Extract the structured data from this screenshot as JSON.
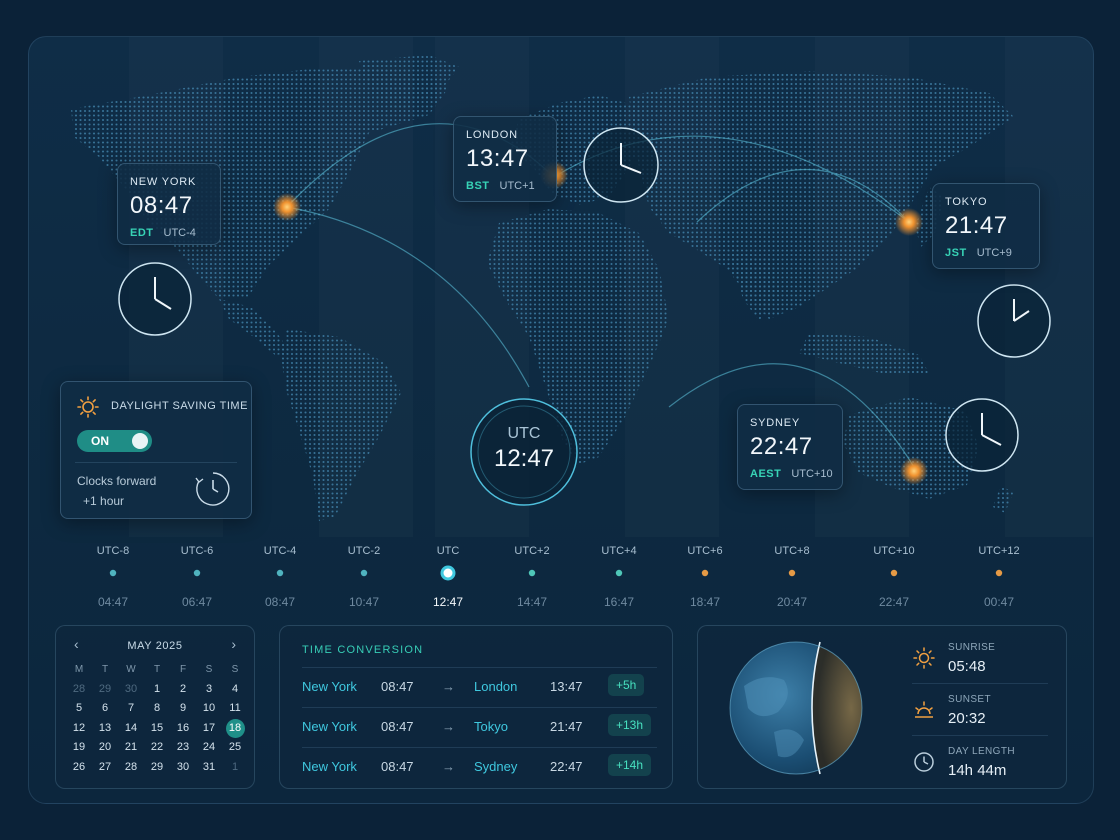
{
  "cities": {
    "new_york": {
      "name": "NEW YORK",
      "time": "08:47",
      "abbr": "EDT",
      "offset": "UTC-4"
    },
    "london": {
      "name": "LONDON",
      "time": "13:47",
      "abbr": "BST",
      "offset": "UTC+1"
    },
    "tokyo": {
      "name": "TOKYO",
      "time": "21:47",
      "abbr": "JST",
      "offset": "UTC+9"
    },
    "sydney": {
      "name": "SYDNEY",
      "time": "22:47",
      "abbr": "AEST",
      "offset": "UTC+10"
    }
  },
  "utc_clock": {
    "label": "UTC",
    "time": "12:47"
  },
  "dst": {
    "title": "DAYLIGHT SAVING TIME",
    "toggle_label": "ON",
    "toggle_on": true,
    "line1": "Clocks forward",
    "line2": "+1 hour"
  },
  "timeline": {
    "zones": [
      "UTC-8",
      "UTC-6",
      "UTC-4",
      "UTC-2",
      "UTC",
      "UTC+2",
      "UTC+4",
      "UTC+6",
      "UTC+8",
      "UTC+10",
      "UTC+12"
    ],
    "times": [
      "04:47",
      "06:47",
      "08:47",
      "10:47",
      "12:47",
      "14:47",
      "16:47",
      "18:47",
      "20:47",
      "22:47",
      "00:47"
    ],
    "active_index": 4
  },
  "calendar": {
    "month": "MAY 2025",
    "prev": "‹",
    "next": "›",
    "weekdays": [
      "M",
      "T",
      "W",
      "T",
      "F",
      "S",
      "S"
    ],
    "days": [
      "28",
      "29",
      "30",
      "1",
      "2",
      "3",
      "4",
      "5",
      "6",
      "7",
      "8",
      "9",
      "10",
      "11",
      "12",
      "13",
      "14",
      "15",
      "16",
      "17",
      "18",
      "19",
      "20",
      "21",
      "22",
      "23",
      "24",
      "25",
      "26",
      "27",
      "28",
      "29",
      "30",
      "31",
      "1"
    ],
    "muted_indices": [
      0,
      1,
      2,
      34
    ],
    "selected": "18"
  },
  "conversion": {
    "title": "TIME CONVERSION",
    "rows": [
      {
        "from": "New York",
        "from_time": "08:47",
        "arrow": "→",
        "to": "London",
        "to_time": "13:47",
        "delta": "+5h"
      },
      {
        "from": "New York",
        "from_time": "08:47",
        "arrow": "→",
        "to": "Tokyo",
        "to_time": "21:47",
        "delta": "+13h"
      },
      {
        "from": "New York",
        "from_time": "08:47",
        "arrow": "→",
        "to": "Sydney",
        "to_time": "22:47",
        "delta": "+14h"
      }
    ]
  },
  "sun": {
    "sunrise_label": "SUNRISE",
    "sunrise": "05:48",
    "sunset_label": "SUNSET",
    "sunset": "20:32",
    "day_length_label": "DAY LENGTH",
    "day_length": "14h 44m"
  },
  "colors": {
    "accent_teal": "#37d3b6",
    "accent_orange": "#f29a3c",
    "background": "#0b2238"
  }
}
